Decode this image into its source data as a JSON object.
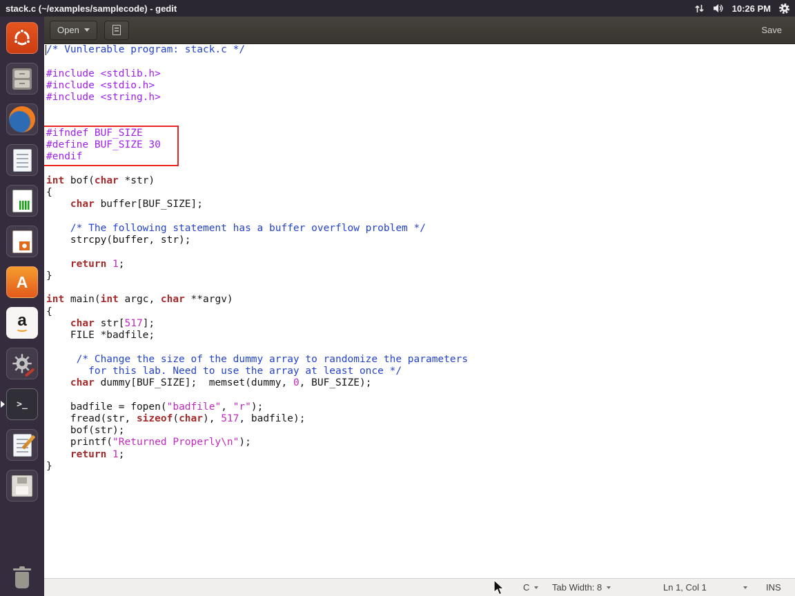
{
  "top_bar": {
    "title": "stack.c (~/examples/samplecode) - gedit",
    "clock": "10:26 PM",
    "indicator_icons": [
      "network-arrows-icon",
      "volume-icon",
      "session-gear-icon"
    ]
  },
  "launcher": {
    "items": [
      "ubuntu-logo",
      "files",
      "firefox",
      "text-editor-document",
      "libreoffice-calc",
      "libreoffice-impress",
      "ubuntu-software",
      "amazon",
      "system-settings",
      "terminal",
      "gedit-pencil",
      "floppy-disk",
      "trash"
    ],
    "running_indicator_on": "terminal"
  },
  "toolbar": {
    "open_label": "Open",
    "save_label": "Save"
  },
  "editor": {
    "file_language": "C",
    "caret_position": "line 1, col 1",
    "annotation": {
      "highlighted_lines": [
        8,
        9,
        10
      ],
      "color": "#e8261f"
    },
    "syntax_colors": {
      "comment": "#2343cb",
      "preprocessor": "#a020f0",
      "keyword": "#a52a2a",
      "number": "#c028c0",
      "string": "#c028c0"
    },
    "lines": [
      [
        [
          "com",
          "/* Vunlerable program: stack.c */"
        ]
      ],
      [],
      [
        [
          "pre",
          "#include <stdlib.h>"
        ]
      ],
      [
        [
          "pre",
          "#include <stdio.h>"
        ]
      ],
      [
        [
          "pre",
          "#include <string.h>"
        ]
      ],
      [],
      [],
      [
        [
          "pre",
          "#ifndef BUF_SIZE"
        ]
      ],
      [
        [
          "pre",
          "#define BUF_SIZE 30"
        ]
      ],
      [
        [
          "pre",
          "#endif"
        ]
      ],
      [],
      [
        [
          "kw",
          "int"
        ],
        [
          "pl",
          " bof("
        ],
        [
          "kw",
          "char"
        ],
        [
          "pl",
          " *str)"
        ]
      ],
      [
        [
          "pl",
          "{"
        ]
      ],
      [
        [
          "pl",
          "    "
        ],
        [
          "kw",
          "char"
        ],
        [
          "pl",
          " buffer[BUF_SIZE];"
        ]
      ],
      [],
      [
        [
          "pl",
          "    "
        ],
        [
          "com",
          "/* The following statement has a buffer overflow problem */"
        ]
      ],
      [
        [
          "pl",
          "    strcpy(buffer, str);"
        ]
      ],
      [],
      [
        [
          "pl",
          "    "
        ],
        [
          "kw",
          "return"
        ],
        [
          "pl",
          " "
        ],
        [
          "num",
          "1"
        ],
        [
          "pl",
          ";"
        ]
      ],
      [
        [
          "pl",
          "}"
        ]
      ],
      [],
      [
        [
          "kw",
          "int"
        ],
        [
          "pl",
          " main("
        ],
        [
          "kw",
          "int"
        ],
        [
          "pl",
          " argc, "
        ],
        [
          "kw",
          "char"
        ],
        [
          "pl",
          " **argv)"
        ]
      ],
      [
        [
          "pl",
          "{"
        ]
      ],
      [
        [
          "pl",
          "    "
        ],
        [
          "kw",
          "char"
        ],
        [
          "pl",
          " str["
        ],
        [
          "num",
          "517"
        ],
        [
          "pl",
          "];"
        ]
      ],
      [
        [
          "pl",
          "    FILE *badfile;"
        ]
      ],
      [],
      [
        [
          "com",
          "     /* Change the size of the dummy array to randomize the parameters"
        ]
      ],
      [
        [
          "com",
          "       for this lab. Need to use the array at least once */"
        ]
      ],
      [
        [
          "pl",
          "    "
        ],
        [
          "kw",
          "char"
        ],
        [
          "pl",
          " dummy[BUF_SIZE];  memset(dummy, "
        ],
        [
          "num",
          "0"
        ],
        [
          "pl",
          ", BUF_SIZE);"
        ]
      ],
      [],
      [
        [
          "pl",
          "    badfile = fopen("
        ],
        [
          "str",
          "\"badfile\""
        ],
        [
          "pl",
          ", "
        ],
        [
          "str",
          "\"r\""
        ],
        [
          "pl",
          ");"
        ]
      ],
      [
        [
          "pl",
          "    fread(str, "
        ],
        [
          "kw",
          "sizeof"
        ],
        [
          "pl",
          "("
        ],
        [
          "kw",
          "char"
        ],
        [
          "pl",
          "), "
        ],
        [
          "num",
          "517"
        ],
        [
          "pl",
          ", badfile);"
        ]
      ],
      [
        [
          "pl",
          "    bof(str);"
        ]
      ],
      [
        [
          "pl",
          "    printf("
        ],
        [
          "str",
          "\"Returned Properly\\n\""
        ],
        [
          "pl",
          ");"
        ]
      ],
      [
        [
          "pl",
          "    "
        ],
        [
          "kw",
          "return"
        ],
        [
          "pl",
          " "
        ],
        [
          "num",
          "1"
        ],
        [
          "pl",
          ";"
        ]
      ],
      [
        [
          "pl",
          "}"
        ]
      ]
    ]
  },
  "status_bar": {
    "language": "C",
    "tab_width": "Tab Width: 8",
    "cursor_position": "Ln 1, Col 1",
    "mode": "INS"
  }
}
